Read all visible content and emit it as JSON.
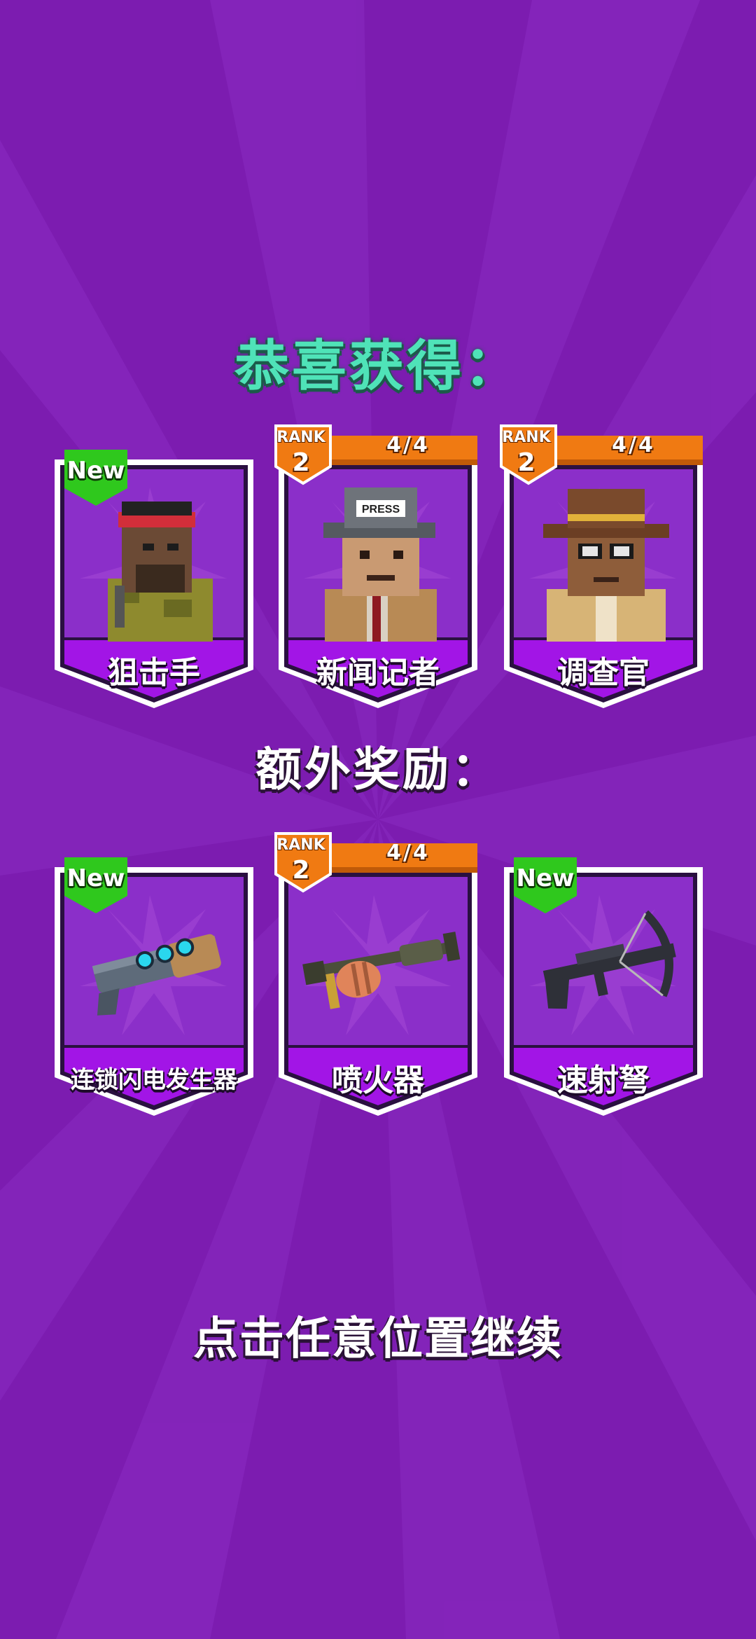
{
  "title": "恭喜获得：",
  "bonus_title": "额外奖励：",
  "tap_hint": "点击任意位置继续",
  "colors": {
    "background": "#7c1cb0",
    "card_frame": "#ffffff",
    "card_inner": "#8b2fc9",
    "name_band": "#a215e6",
    "new_badge": "#2fc81d",
    "rank_orange": "#f07a12",
    "title_green": "#4fe3b8"
  },
  "characters": [
    {
      "name": "狙击手",
      "new_label": "New",
      "icon": "sniper-character-icon"
    },
    {
      "name": "新闻记者",
      "rank_label": "RANK",
      "rank": "2",
      "count": "4/4",
      "icon": "reporter-character-icon",
      "hat_text": "PRESS"
    },
    {
      "name": "调查官",
      "rank_label": "RANK",
      "rank": "2",
      "count": "4/4",
      "icon": "investigator-character-icon"
    }
  ],
  "bonus": [
    {
      "name": "连锁闪电发生器",
      "new_label": "New",
      "icon": "lightning-generator-icon"
    },
    {
      "name": "喷火器",
      "rank_label": "RANK",
      "rank": "2",
      "count": "4/4",
      "icon": "flamethrower-icon"
    },
    {
      "name": "速射弩",
      "new_label": "New",
      "icon": "rapid-crossbow-icon"
    }
  ]
}
